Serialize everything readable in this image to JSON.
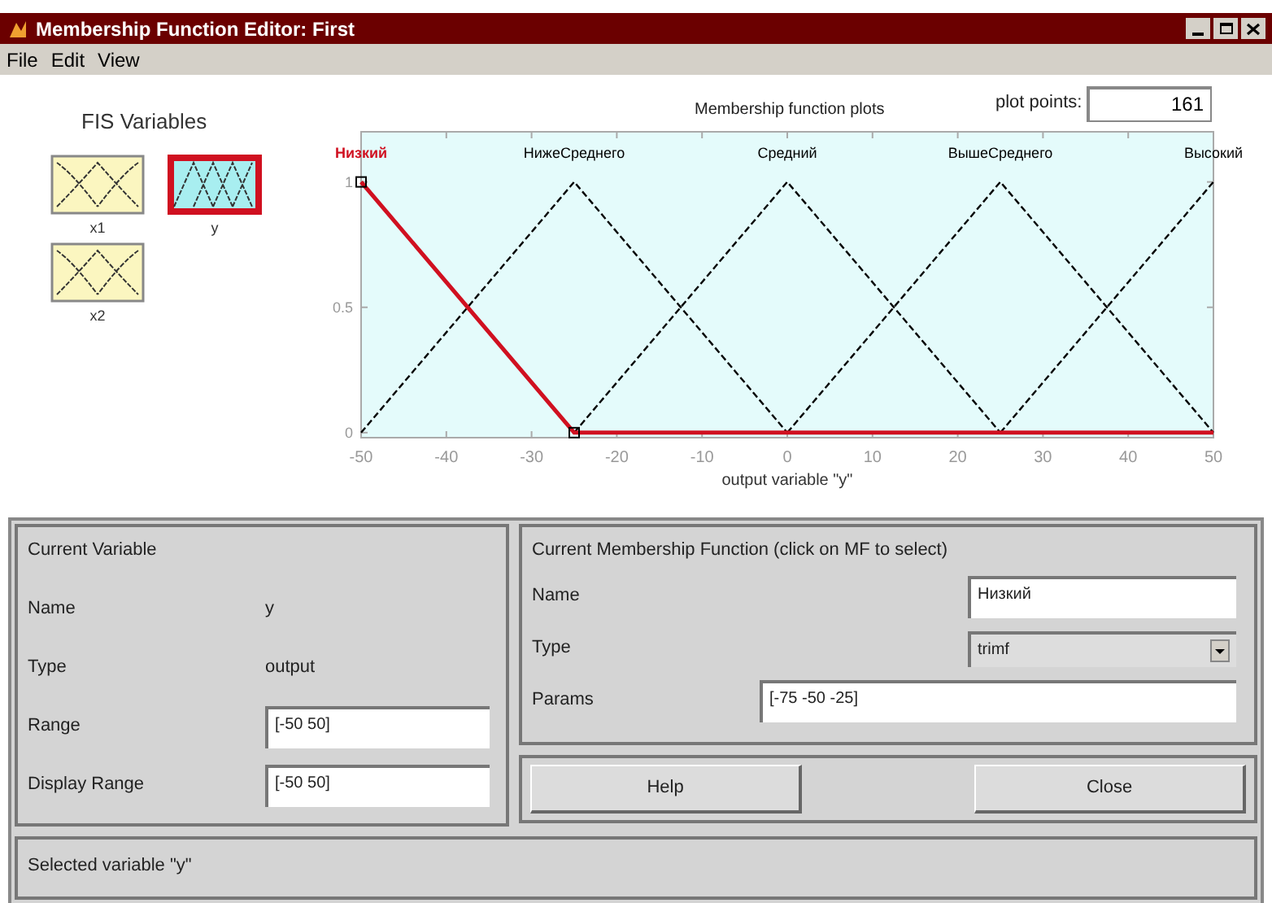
{
  "window": {
    "title": "Membership Function Editor: First"
  },
  "menu": [
    "File",
    "Edit",
    "View"
  ],
  "fis_variables": {
    "title": "FIS Variables",
    "items": [
      {
        "label": "x1",
        "kind": "input",
        "selected": false
      },
      {
        "label": "y",
        "kind": "output",
        "selected": true
      },
      {
        "label": "x2",
        "kind": "input",
        "selected": false
      }
    ]
  },
  "plot": {
    "title": "Membership function plots",
    "plot_points_label": "plot points:",
    "plot_points": "161",
    "chart_data": {
      "type": "line",
      "xlabel": "output variable \"y\"",
      "x": [
        -50,
        -25,
        0,
        25,
        50
      ],
      "series": [
        {
          "name": "Низкий",
          "color": "#d01020",
          "line_style": "solid",
          "values": [
            1,
            0,
            0,
            0,
            0
          ]
        },
        {
          "name": "НижеСреднего",
          "color": "#000000",
          "line_style": "dashed",
          "values": [
            0,
            1,
            0,
            null,
            null
          ]
        },
        {
          "name": "Средний",
          "color": "#000000",
          "line_style": "dashed",
          "values": [
            null,
            0,
            1,
            0,
            null
          ]
        },
        {
          "name": "ВышеСреднего",
          "color": "#000000",
          "line_style": "dashed",
          "values": [
            null,
            null,
            0,
            1,
            0
          ]
        },
        {
          "name": "Высокий",
          "color": "#000000",
          "line_style": "dashed",
          "values": [
            null,
            null,
            null,
            0,
            1
          ]
        }
      ],
      "xlim": [
        -50,
        50
      ],
      "ylim": [
        -0.02,
        1.2
      ],
      "xticks": [
        -50,
        -40,
        -30,
        -20,
        -10,
        0,
        10,
        20,
        30,
        40,
        50
      ],
      "yticks": [
        0,
        0.5,
        1
      ]
    }
  },
  "current_variable": {
    "title": "Current Variable",
    "name_label": "Name",
    "name": "y",
    "type_label": "Type",
    "type": "output",
    "range_label": "Range",
    "range": "[-50 50]",
    "display_range_label": "Display Range",
    "display_range": "[-50 50]"
  },
  "current_mf": {
    "title": "Current Membership Function (click on MF to select)",
    "name_label": "Name",
    "name": "Низкий",
    "type_label": "Type",
    "type": "trimf",
    "params_label": "Params",
    "params": "[-75 -50 -25]"
  },
  "buttons": [
    "Help",
    "Close"
  ],
  "status": "Selected variable \"y\""
}
